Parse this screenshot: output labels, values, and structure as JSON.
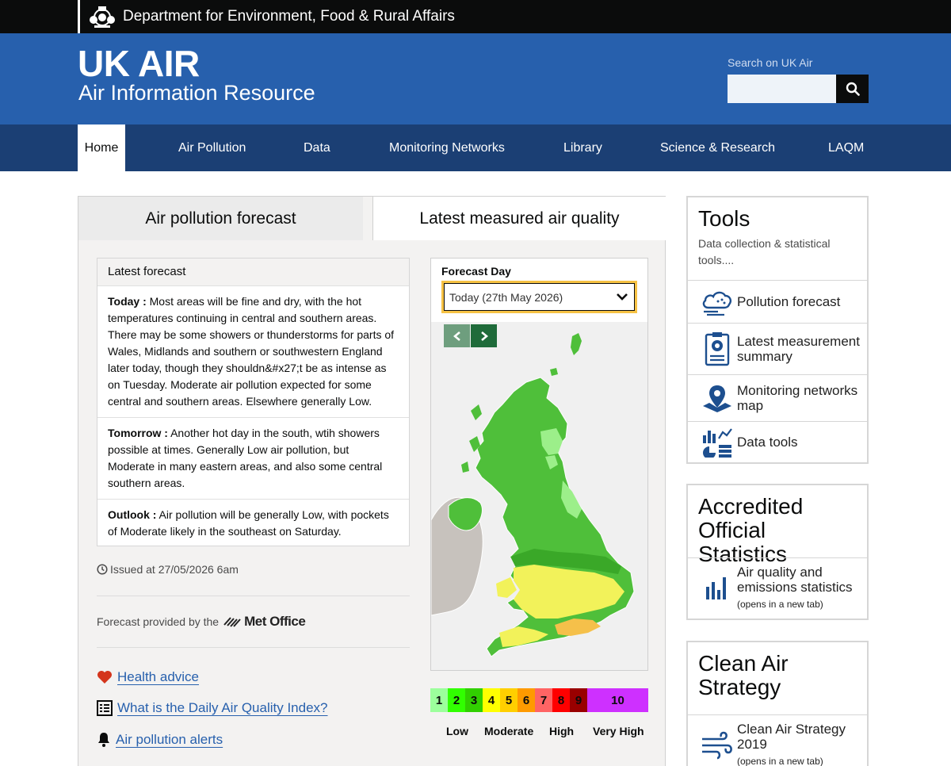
{
  "defra": {
    "title": "Department for Environment, Food & Rural Affairs"
  },
  "header": {
    "title": "UK AIR",
    "subtitle": "Air Information Resource",
    "search_label": "Search on UK Air"
  },
  "nav": {
    "items": [
      "Home",
      "Air Pollution",
      "Data",
      "Monitoring Networks",
      "Library",
      "Science & Research",
      "LAQM"
    ]
  },
  "tabs": {
    "forecast": "Air pollution forecast",
    "measured": "Latest measured air quality"
  },
  "forecast": {
    "heading": "Latest forecast",
    "entries": [
      {
        "label": "Today :",
        "text": " Most areas will be fine and dry, with the hot temperatures continuing in central and southern areas. There may be some showers or thunderstorms for parts of Wales, Midlands and southern or southwestern England later today, though they shouldn&#x27;t be as intense as on Tuesday. Moderate air pollution expected for some central and southern areas. Elsewhere generally Low."
      },
      {
        "label": "Tomorrow :",
        "text": " Another hot day in the south, wtih showers possible at times. Generally Low air pollution, but Moderate in many eastern areas, and also some central southern areas."
      },
      {
        "label": "Outlook :",
        "text": " Air pollution will be generally Low, with pockets of Moderate likely in the southeast on Saturday."
      }
    ],
    "issued": "Issued at 27/05/2026 6am",
    "provided_by": "Forecast provided by the",
    "provider": "Met Office",
    "links": {
      "health": "Health advice",
      "daqi": "What is the Daily Air Quality Index?",
      "alerts": "Air pollution alerts"
    }
  },
  "map": {
    "day_label": "Forecast Day",
    "day_selected": "Today (27th May 2026)"
  },
  "scale": {
    "bands": [
      {
        "value": "1",
        "color": "#9cff9c"
      },
      {
        "value": "2",
        "color": "#31ff00"
      },
      {
        "value": "3",
        "color": "#31cf00"
      },
      {
        "value": "4",
        "color": "#ffff00"
      },
      {
        "value": "5",
        "color": "#ffcf00"
      },
      {
        "value": "6",
        "color": "#ff9a00"
      },
      {
        "value": "7",
        "color": "#ff6464"
      },
      {
        "value": "8",
        "color": "#ff0000"
      },
      {
        "value": "9",
        "color": "#990000"
      },
      {
        "value": "10",
        "color": "#ce30ff"
      }
    ],
    "labels": {
      "low": "Low",
      "moderate": "Moderate",
      "high": "High",
      "very_high": "Very High"
    }
  },
  "tools": {
    "title": "Tools",
    "desc": "Data collection & statistical tools....",
    "items": [
      "Pollution forecast",
      "Latest measurement summary",
      "Monitoring networks map",
      "Data tools"
    ]
  },
  "stats": {
    "title": "Accredited Official Statistics",
    "item": "Air quality and emissions statistics",
    "note": "(opens in a new tab)"
  },
  "clean_air": {
    "title": "Clean Air Strategy",
    "item": "Clean Air Strategy 2019",
    "note": "(opens in a new tab)"
  }
}
